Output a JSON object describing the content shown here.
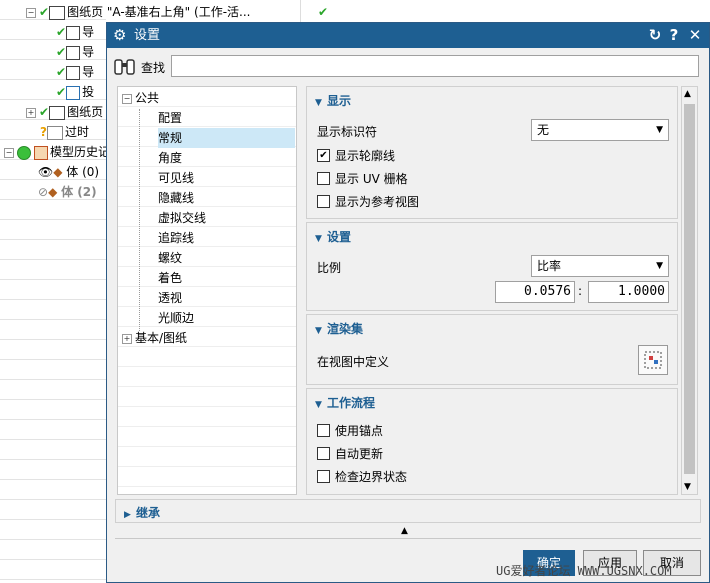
{
  "background": {
    "rows": [
      {
        "label": "图纸页 \"A-基准右上角\" (工作-活...",
        "status": "✔"
      },
      {
        "label": "导"
      },
      {
        "label": "导"
      },
      {
        "label": "导"
      },
      {
        "label": "投"
      },
      {
        "label": "图纸页"
      },
      {
        "label": "过时"
      },
      {
        "label": "模型历史记"
      },
      {
        "label": "体 (0)"
      },
      {
        "label": "体 (2)"
      }
    ]
  },
  "dialog": {
    "title": "设置",
    "icons": {
      "title": "gear-icon",
      "reset": "reset-icon",
      "help": "help-icon",
      "close": "close-icon"
    },
    "search": {
      "label": "查找",
      "value": "",
      "placeholder": ""
    },
    "tree": {
      "root": "公共",
      "children": [
        "配置",
        "常规",
        "角度",
        "可见线",
        "隐藏线",
        "虚拟交线",
        "追踪线",
        "螺纹",
        "着色",
        "透视",
        "光顺边"
      ],
      "selected": "常规",
      "second_root": "基本/图纸"
    },
    "sections": {
      "display": {
        "title": "显示",
        "marker_label": "显示标识符",
        "marker_value": "无",
        "checkboxes": [
          {
            "label": "显示轮廓线",
            "checked": true
          },
          {
            "label": "显示 UV 栅格",
            "checked": false
          },
          {
            "label": "显示为参考视图",
            "checked": false
          }
        ]
      },
      "settings": {
        "title": "设置",
        "scale_label": "比例",
        "scale_value": "比率",
        "ratio_num": "0.0576",
        "ratio_sep": ":",
        "ratio_den": "1.0000"
      },
      "render": {
        "title": "渲染集",
        "label": "在视图中定义"
      },
      "workflow": {
        "title": "工作流程",
        "checkboxes": [
          {
            "label": "使用锚点",
            "checked": false
          },
          {
            "label": "自动更新",
            "checked": false
          },
          {
            "label": "检查边界状态",
            "checked": false
          }
        ]
      },
      "inherit": {
        "title": "继承"
      }
    },
    "buttons": {
      "ok": "确定",
      "apply": "应用",
      "cancel": "取消"
    },
    "watermark": "UG爱好者论坛 WWW.UGSNX.COM",
    "accent_color": "#1e5f92"
  }
}
